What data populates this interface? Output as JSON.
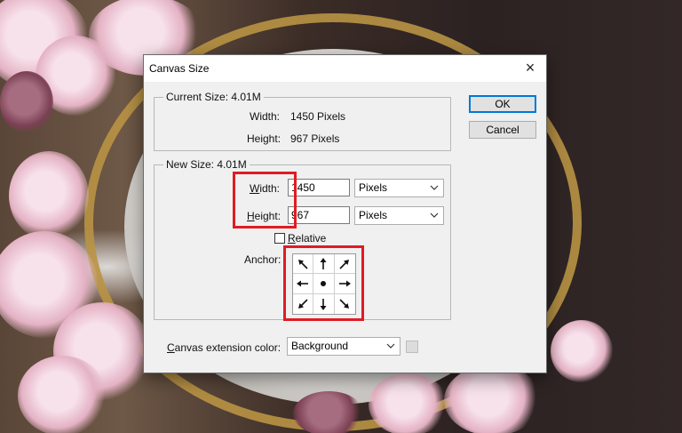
{
  "dialog": {
    "title": "Canvas Size",
    "close_glyph": "×",
    "buttons": {
      "ok": "OK",
      "cancel": "Cancel"
    }
  },
  "current_size": {
    "legend": "Current Size: 4.01M",
    "width_label": "Width:",
    "width_value": "1450 Pixels",
    "height_label": "Height:",
    "height_value": "967 Pixels"
  },
  "new_size": {
    "legend": "New Size: 4.01M",
    "width": {
      "label_mnemonic": "W",
      "label_rest": "idth:",
      "value": "1450",
      "unit": "Pixels"
    },
    "height": {
      "label_mnemonic": "H",
      "label_rest": "eight:",
      "value": "967",
      "unit": "Pixels"
    },
    "relative": {
      "label_mnemonic": "R",
      "label_rest": "elative",
      "checked": false
    },
    "anchor_label": "Anchor:",
    "anchor_arrows": [
      "arrow-up-left",
      "arrow-up",
      "arrow-up-right",
      "arrow-left",
      "center-dot",
      "arrow-right",
      "arrow-down-left",
      "arrow-down",
      "arrow-down-right"
    ]
  },
  "extension": {
    "label_mnemonic": "C",
    "label_rest": "anvas extension color:",
    "value": "Background"
  },
  "colors": {
    "highlight": "#e01b24",
    "default_button_border": "#0078d7"
  }
}
